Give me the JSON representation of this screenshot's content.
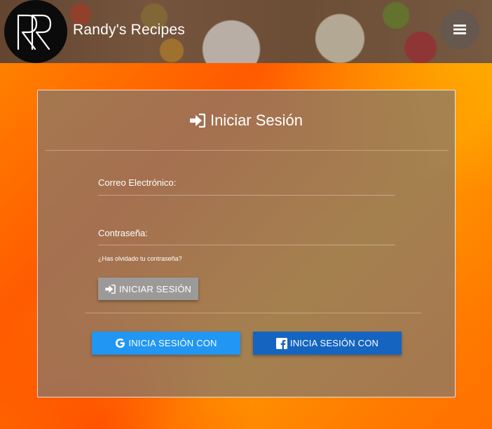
{
  "header": {
    "site_title": "Randy's Recipes",
    "logo_text": "RR",
    "menu_icon": "hamburger-menu-icon"
  },
  "login": {
    "title": "Iniciar Sesión",
    "title_icon": "sign-in-icon",
    "email_label": "Correo Electrónico:",
    "email_value": "",
    "password_label": "Contraseña:",
    "password_value": "",
    "forgot_link": "¿Has olvidado tu contraseña?",
    "submit_label": "INICIAR SESIÓN",
    "google_label": "INICIA SESIÓN CON",
    "google_icon": "google-icon",
    "facebook_label": "INICIA SESIÓN CON",
    "facebook_icon": "facebook-icon"
  },
  "colors": {
    "google": "#2196f3",
    "facebook": "#1565c0",
    "background": "#ff7a00"
  }
}
